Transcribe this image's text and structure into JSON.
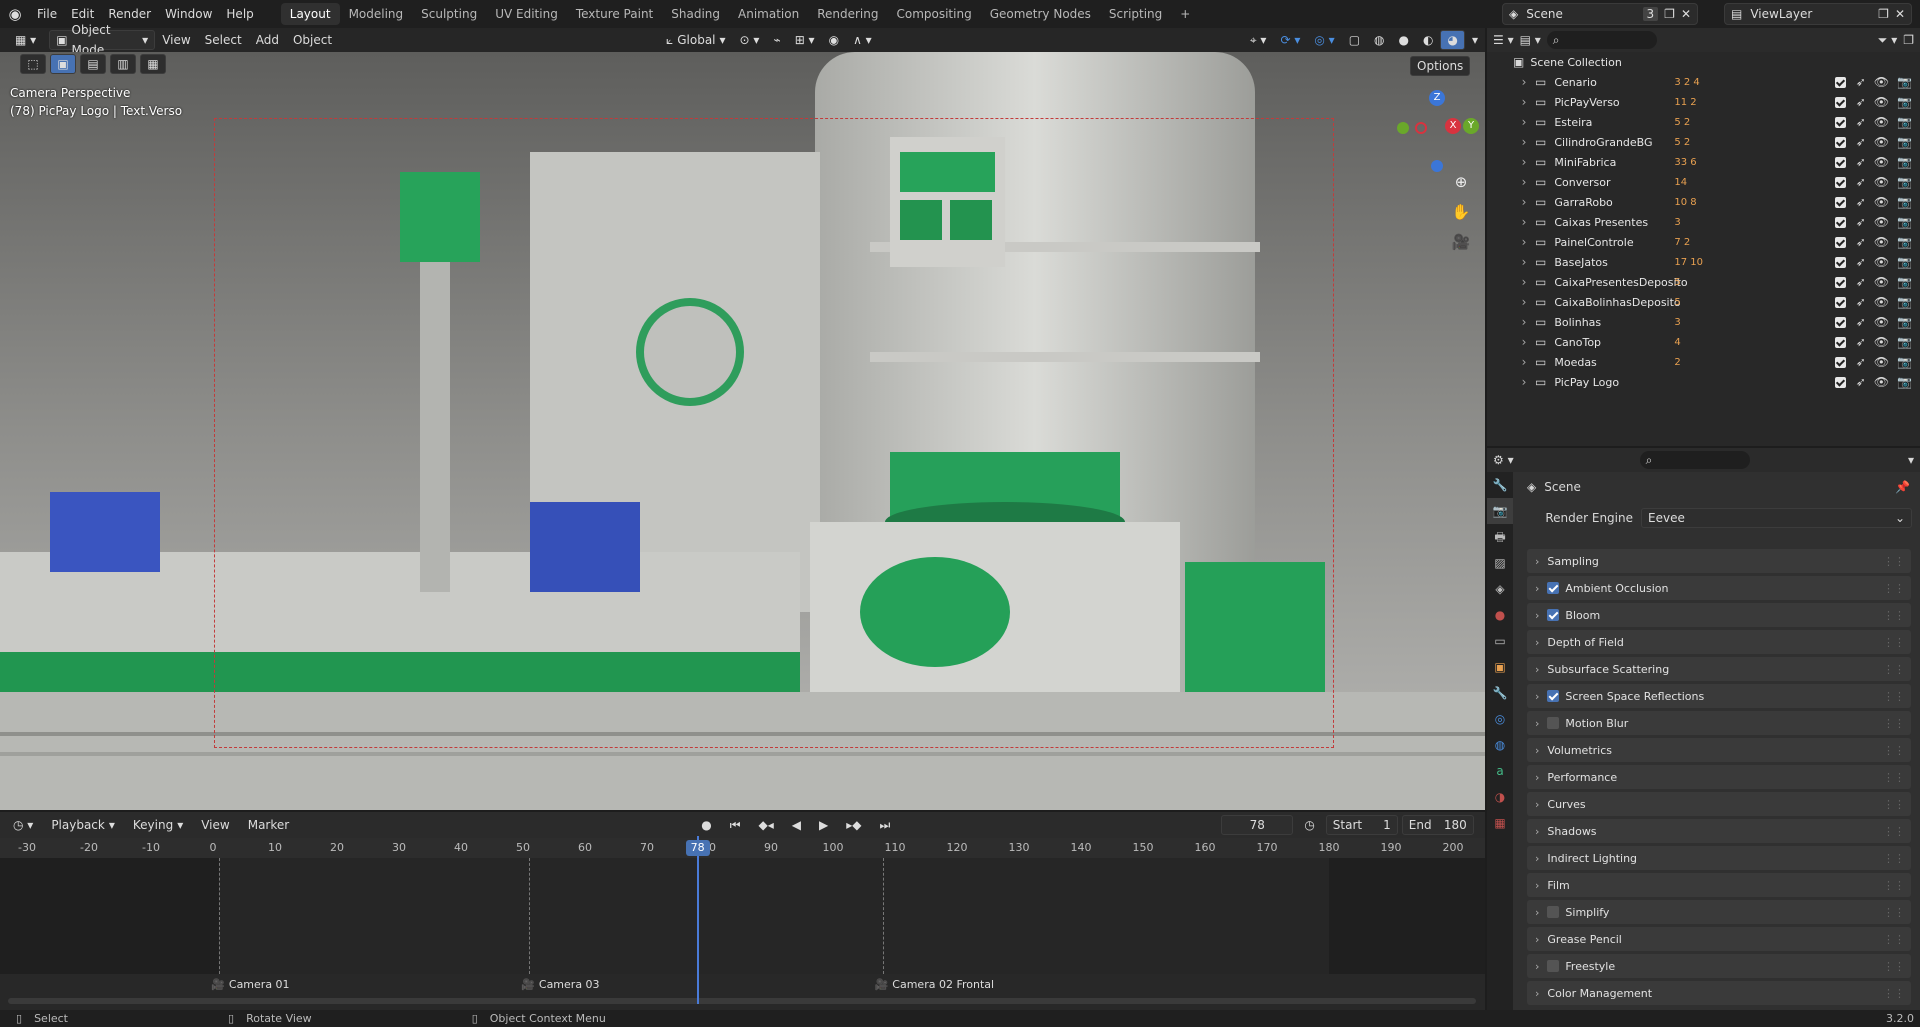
{
  "app": {
    "version": "3.2.0"
  },
  "menu": [
    "File",
    "Edit",
    "Render",
    "Window",
    "Help"
  ],
  "workspaces": [
    "Layout",
    "Modeling",
    "Sculpting",
    "UV Editing",
    "Texture Paint",
    "Shading",
    "Animation",
    "Rendering",
    "Compositing",
    "Geometry Nodes",
    "Scripting"
  ],
  "active_workspace": "Layout",
  "scene": {
    "name": "Scene",
    "users": "3"
  },
  "view_layer": "ViewLayer",
  "viewport_header": {
    "mode": "Object Mode",
    "view": "View",
    "select": "Select",
    "add": "Add",
    "object": "Object",
    "orientation": "Global",
    "options": "Options"
  },
  "viewport": {
    "camera_label": "Camera Perspective",
    "object_label": "(78) PicPay Logo | Text.Verso",
    "axes": {
      "z": "Z",
      "x": "X",
      "y": "Y"
    }
  },
  "outliner": {
    "root": "Scene Collection",
    "collections": [
      {
        "name": "Cenario",
        "badges": "3 2 4"
      },
      {
        "name": "PicPayVerso",
        "badges": "11 2"
      },
      {
        "name": "Esteira",
        "badges": "5 2"
      },
      {
        "name": "CilindroGrandeBG",
        "badges": "5 2"
      },
      {
        "name": "MiniFabrica",
        "badges": "33 6"
      },
      {
        "name": "Conversor",
        "badges": "14"
      },
      {
        "name": "GarraRobo",
        "badges": "10 8"
      },
      {
        "name": "Caixas Presentes",
        "badges": "3"
      },
      {
        "name": "PainelControle",
        "badges": "7 2"
      },
      {
        "name": "BaseJatos",
        "badges": "17 10"
      },
      {
        "name": "CaixaPresentesDeposito",
        "badges": "5"
      },
      {
        "name": "CaixaBolinhasDeposito",
        "badges": "5"
      },
      {
        "name": "Bolinhas",
        "badges": "3"
      },
      {
        "name": "CanoTop",
        "badges": "4"
      },
      {
        "name": "Moedas",
        "badges": "2"
      },
      {
        "name": "PicPay Logo",
        "badges": ""
      }
    ]
  },
  "properties": {
    "context": "Scene",
    "render_engine_label": "Render Engine",
    "render_engine": "Eevee",
    "panels": [
      {
        "label": "Sampling",
        "checkbox": null
      },
      {
        "label": "Ambient Occlusion",
        "checkbox": true
      },
      {
        "label": "Bloom",
        "checkbox": true
      },
      {
        "label": "Depth of Field",
        "checkbox": null
      },
      {
        "label": "Subsurface Scattering",
        "checkbox": null
      },
      {
        "label": "Screen Space Reflections",
        "checkbox": true
      },
      {
        "label": "Motion Blur",
        "checkbox": false
      },
      {
        "label": "Volumetrics",
        "checkbox": null
      },
      {
        "label": "Performance",
        "checkbox": null
      },
      {
        "label": "Curves",
        "checkbox": null
      },
      {
        "label": "Shadows",
        "checkbox": null
      },
      {
        "label": "Indirect Lighting",
        "checkbox": null
      },
      {
        "label": "Film",
        "checkbox": null
      },
      {
        "label": "Simplify",
        "checkbox": false
      },
      {
        "label": "Grease Pencil",
        "checkbox": null
      },
      {
        "label": "Freestyle",
        "checkbox": false
      },
      {
        "label": "Color Management",
        "checkbox": null
      }
    ]
  },
  "timeline": {
    "playback": "Playback",
    "keying": "Keying",
    "view": "View",
    "marker": "Marker",
    "current_frame": "78",
    "start_label": "Start",
    "start": "1",
    "end_label": "End",
    "end": "180",
    "ticks": [
      "-30",
      "-20",
      "-10",
      "0",
      "10",
      "20",
      "30",
      "40",
      "50",
      "60",
      "70",
      "80",
      "90",
      "100",
      "110",
      "120",
      "130",
      "140",
      "150",
      "160",
      "170",
      "180",
      "190",
      "200"
    ],
    "markers": [
      "Camera 01",
      "Camera 03",
      "Camera 02 Frontal"
    ]
  },
  "status": {
    "select": "Select",
    "rotate": "Rotate View",
    "context_menu": "Object Context Menu"
  }
}
